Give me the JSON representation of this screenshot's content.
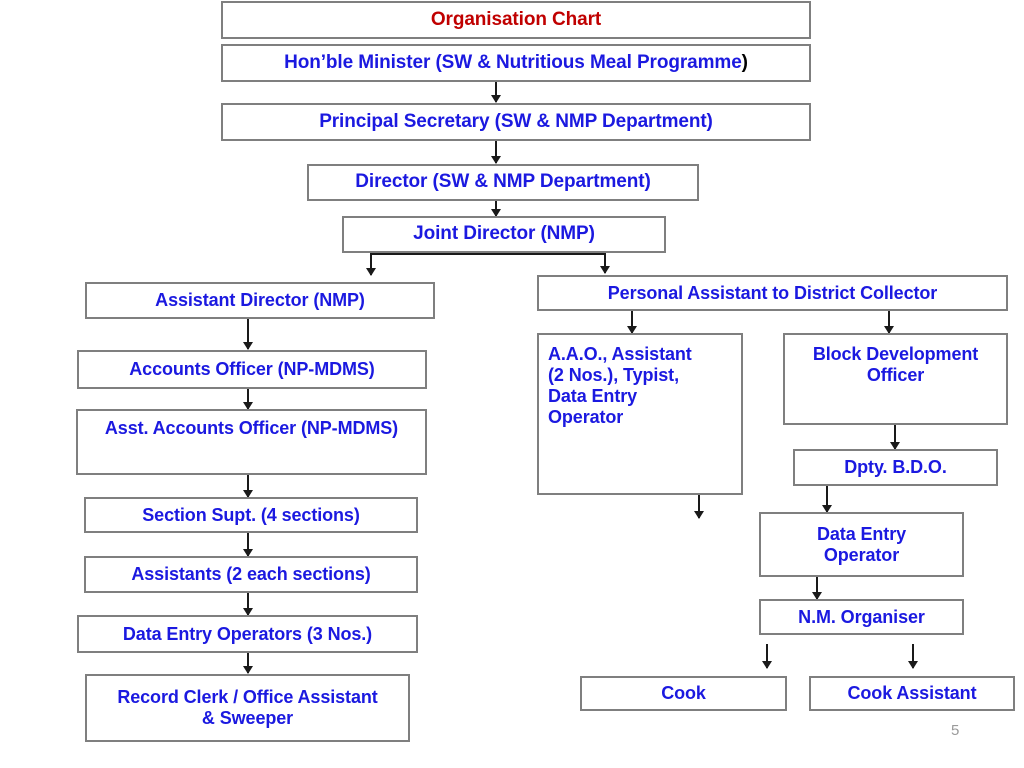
{
  "slide": {
    "page_number": "5",
    "colors": {
      "title_text": "#c00000",
      "node_text": "#1b19e0",
      "box_border": "#7f7f7f",
      "connector": "#1a1a1a",
      "background": "#ffffff",
      "page_number_text": "#9a9a9a"
    }
  },
  "chart_data": {
    "type": "diagram",
    "title": "Organisation Chart",
    "orientation": "top-down",
    "nodes": [
      {
        "id": "title",
        "label": "Organisation Chart"
      },
      {
        "id": "minister",
        "label": "Hon’ble Minister (SW & Nutritious Meal Programme",
        "trailing_paren": ")"
      },
      {
        "id": "principal_sec",
        "label": "Principal Secretary (SW & NMP Department)"
      },
      {
        "id": "director",
        "label": "Director (SW & NMP Department)"
      },
      {
        "id": "joint_director",
        "label": "Joint Director (NMP)"
      },
      {
        "id": "asst_director",
        "label": "Assistant  Director (NMP)"
      },
      {
        "id": "accounts_officer",
        "label": "Accounts Officer (NP-MDMS)"
      },
      {
        "id": "asst_accounts",
        "label": "Asst. Accounts Officer (NP-MDMS)"
      },
      {
        "id": "section_supt",
        "label": "Section Supt. (4 sections)"
      },
      {
        "id": "assistants",
        "label": "Assistants (2 each sections)"
      },
      {
        "id": "data_entry_ops",
        "label": "Data Entry Operators (3 Nos.)"
      },
      {
        "id": "record_clerk",
        "label": "Record Clerk / Office Assistant & Sweeper",
        "lines": [
          "Record Clerk / Office Assistant",
          "& Sweeper"
        ]
      },
      {
        "id": "pa_collector",
        "label": "Personal Assistant to District Collector"
      },
      {
        "id": "aao",
        "label": "A.A.O.,  Assistant (2 Nos.), Typist, Data Entry Operator",
        "lines": [
          "A.A.O.,  Assistant",
          "(2 Nos.), Typist,",
          "Data Entry",
          "Operator"
        ]
      },
      {
        "id": "bdo",
        "label": "Block Development Officer",
        "lines": [
          "Block Development",
          "Officer"
        ]
      },
      {
        "id": "dpty_bdo",
        "label": "Dpty. B.D.O."
      },
      {
        "id": "deo_block",
        "label": "Data Entry Operator",
        "lines": [
          "Data Entry",
          "Operator"
        ]
      },
      {
        "id": "nm_organiser",
        "label": "N.M. Organiser"
      },
      {
        "id": "cook",
        "label": "Cook"
      },
      {
        "id": "cook_assistant",
        "label": "Cook Assistant"
      }
    ],
    "edges": [
      {
        "from": "minister",
        "to": "principal_sec"
      },
      {
        "from": "principal_sec",
        "to": "director"
      },
      {
        "from": "director",
        "to": "joint_director"
      },
      {
        "from": "joint_director",
        "to": "asst_director"
      },
      {
        "from": "joint_director",
        "to": "pa_collector"
      },
      {
        "from": "asst_director",
        "to": "accounts_officer"
      },
      {
        "from": "accounts_officer",
        "to": "asst_accounts"
      },
      {
        "from": "asst_accounts",
        "to": "section_supt"
      },
      {
        "from": "section_supt",
        "to": "assistants"
      },
      {
        "from": "assistants",
        "to": "data_entry_ops"
      },
      {
        "from": "data_entry_ops",
        "to": "record_clerk"
      },
      {
        "from": "pa_collector",
        "to": "aao"
      },
      {
        "from": "pa_collector",
        "to": "bdo"
      },
      {
        "from": "aao",
        "to": "(dangling)"
      },
      {
        "from": "bdo",
        "to": "dpty_bdo"
      },
      {
        "from": "dpty_bdo",
        "to": "deo_block"
      },
      {
        "from": "deo_block",
        "to": "nm_organiser"
      },
      {
        "from": "nm_organiser",
        "to": "cook"
      },
      {
        "from": "nm_organiser",
        "to": "cook_assistant"
      }
    ]
  }
}
